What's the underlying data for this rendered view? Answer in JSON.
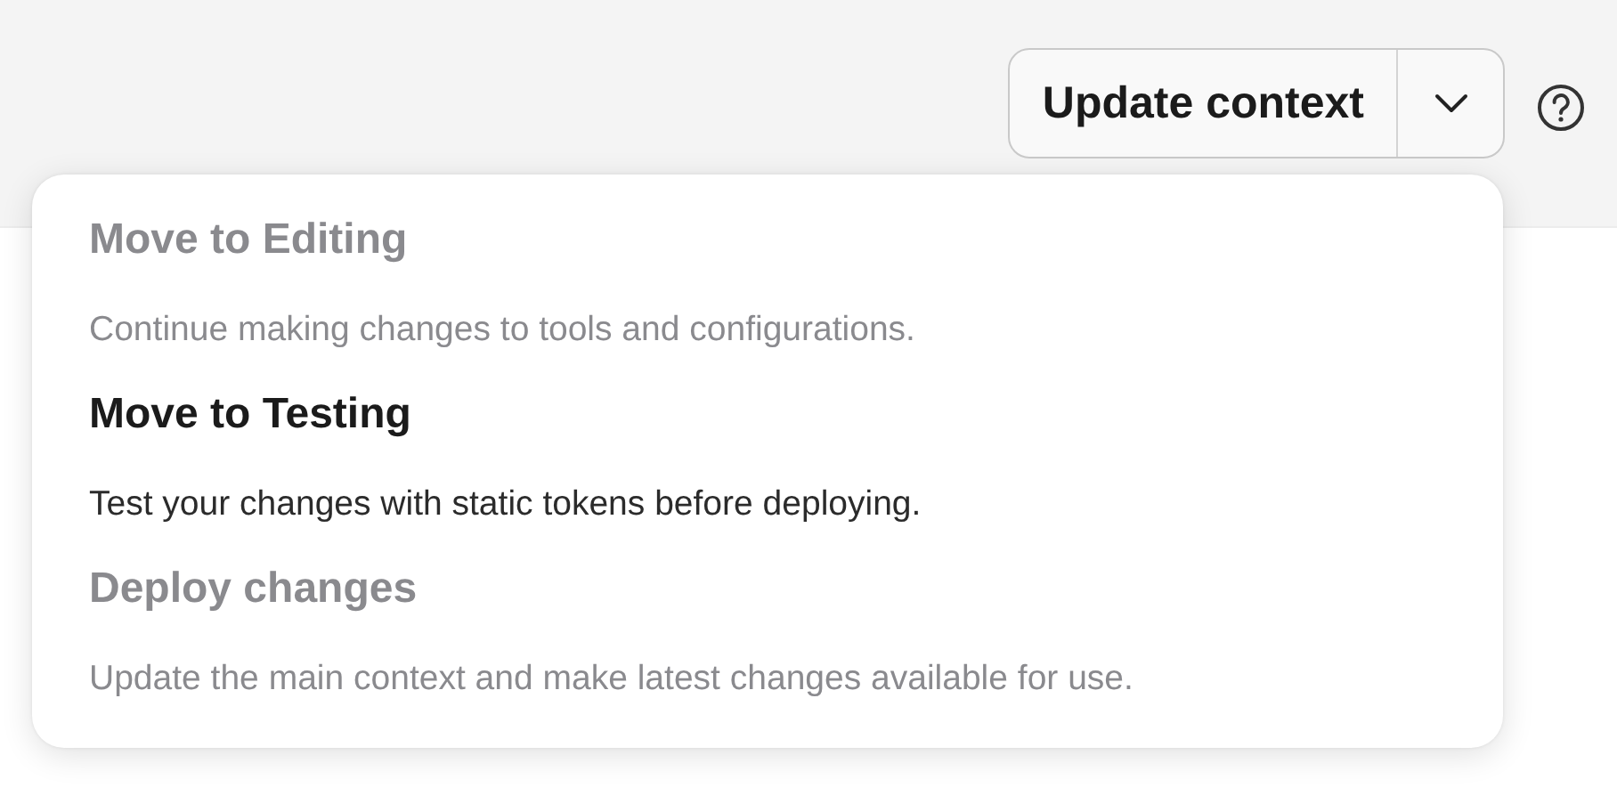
{
  "toolbar": {
    "primary_button": "Update context"
  },
  "menu": {
    "items": [
      {
        "title": "Move to Editing",
        "description": "Continue making changes to tools and configurations.",
        "disabled": true
      },
      {
        "title": "Move to Testing",
        "description": "Test your changes with static tokens before deploying.",
        "disabled": false
      },
      {
        "title": "Deploy changes",
        "description": "Update the main context and make latest changes available for use.",
        "disabled": true
      }
    ]
  }
}
